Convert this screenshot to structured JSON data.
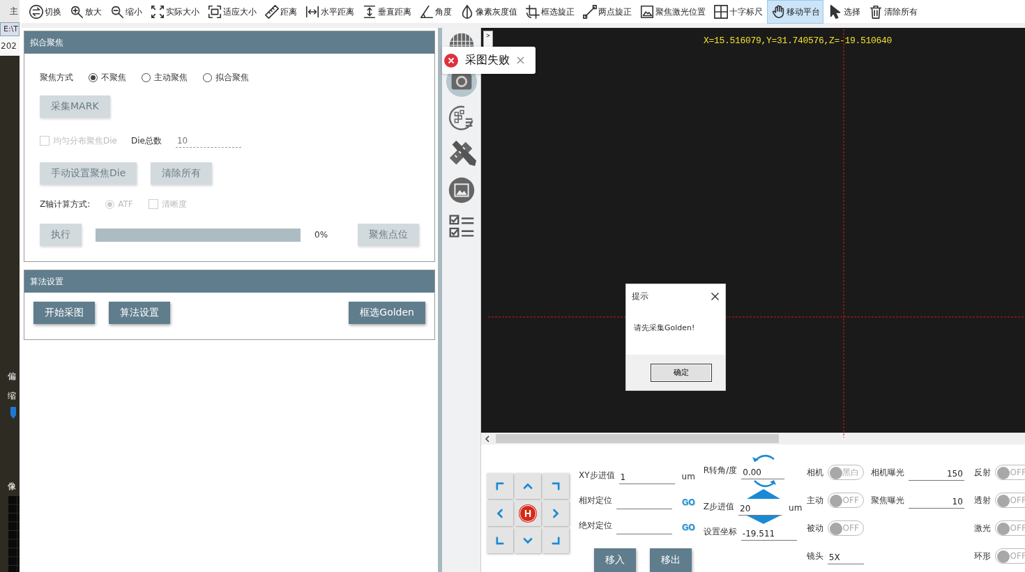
{
  "background_app": {
    "texts": [
      "主",
      "E:\\T",
      "202",
      "偏",
      "缩",
      "像"
    ]
  },
  "toolbar": {
    "items": [
      {
        "kind": "swap",
        "label": "切换",
        "selected": false
      },
      {
        "kind": "zoom_in",
        "label": "放大",
        "selected": false
      },
      {
        "kind": "zoom_out",
        "label": "缩小",
        "selected": false
      },
      {
        "kind": "actual_size",
        "label": "实际大小",
        "selected": false
      },
      {
        "kind": "fit",
        "label": "适应大小",
        "selected": false
      },
      {
        "kind": "ruler",
        "label": "距离",
        "selected": false
      },
      {
        "kind": "hdist",
        "label": "水平距离",
        "selected": false
      },
      {
        "kind": "vdist",
        "label": "垂直距离",
        "selected": false
      },
      {
        "kind": "angle",
        "label": "角度",
        "selected": false
      },
      {
        "kind": "gray",
        "label": "像素灰度值",
        "selected": false
      },
      {
        "kind": "rotate_frame",
        "label": "框选旋正",
        "selected": false
      },
      {
        "kind": "two_point",
        "label": "两点旋正",
        "selected": false
      },
      {
        "kind": "image",
        "label": "聚焦激光位置",
        "selected": false
      },
      {
        "kind": "cross_ruler",
        "label": "十字标尺",
        "selected": false
      },
      {
        "kind": "hand",
        "label": "移动平台",
        "selected": true
      },
      {
        "kind": "cursor",
        "label": "选择",
        "selected": false
      },
      {
        "kind": "trash",
        "label": "清除所有",
        "selected": false
      }
    ]
  },
  "focus_section": {
    "title": "拟合聚焦",
    "mode": {
      "label": "聚焦方式",
      "options": [
        {
          "label": "不聚焦",
          "selected": true
        },
        {
          "label": "主动聚焦",
          "selected": false
        },
        {
          "label": "拟合聚焦",
          "selected": false
        }
      ]
    },
    "mark_button": {
      "label": "采集MARK",
      "disabled": true
    },
    "even_checkbox": {
      "label": "均匀分布聚焦Die",
      "checked": false,
      "disabled": true
    },
    "die_count": {
      "label": "Die总数",
      "value": "10",
      "disabled": true
    },
    "buttons": [
      {
        "label": "手动设置聚焦Die",
        "disabled": true
      },
      {
        "label": "清除所有",
        "disabled": true
      }
    ],
    "z_mode": {
      "label": "Z轴计算方式:",
      "atf": {
        "label": "ATF",
        "selected": true,
        "disabled": true
      },
      "clarity": {
        "label": "清晰度",
        "checked": false,
        "disabled": true
      }
    },
    "execute": {
      "label": "执行",
      "disabled": true
    },
    "progress": {
      "level": 0,
      "reading": "0%"
    },
    "points_button": {
      "label": "聚焦点位",
      "disabled": true
    }
  },
  "algorithm_section": {
    "title": "算法设置",
    "buttons": [
      {
        "label": "开始采图",
        "disabled": false
      },
      {
        "label": "算法设置",
        "disabled": false
      },
      {
        "label": "框选Golden",
        "disabled": false
      }
    ]
  },
  "side_tools": [
    {
      "kind": "grid",
      "selected": false
    },
    {
      "kind": "camera",
      "selected": true
    },
    {
      "kind": "wafer",
      "selected": false
    },
    {
      "kind": "tools",
      "selected": false
    },
    {
      "kind": "frame",
      "selected": false
    },
    {
      "kind": "checklist",
      "selected": false
    }
  ],
  "viewer": {
    "expand_button": ">",
    "coordinates": "X=15.516079,Y=31.740576,Z=-19.510640"
  },
  "toast": {
    "message": "采图失败"
  },
  "dialog": {
    "title": "提示",
    "message": "请先采集Golden!",
    "button": "确定"
  },
  "motion": {
    "pad": [
      {
        "kind": "tl"
      },
      {
        "kind": "up"
      },
      {
        "kind": "tr"
      },
      {
        "kind": "left"
      },
      {
        "kind": "home",
        "label": "H"
      },
      {
        "kind": "right"
      },
      {
        "kind": "bl"
      },
      {
        "kind": "down"
      },
      {
        "kind": "br"
      }
    ],
    "xy_step": {
      "label": "XY步进值",
      "value": "1",
      "unit": "um"
    },
    "positions": [
      {
        "label": "相对定位",
        "go": "GO"
      },
      {
        "label": "绝对定位",
        "go": "GO"
      }
    ],
    "buttons": [
      "移入",
      "移出"
    ]
  },
  "axis": {
    "rotation": {
      "label": "R转角/度",
      "value": "0.00"
    },
    "z_step": {
      "label": "Z步进值",
      "value": "20",
      "unit": "um"
    },
    "set_coord": {
      "label": "设置坐标",
      "value": "-19.511"
    }
  },
  "camera": {
    "toggles": [
      {
        "label": "相机",
        "text": "黑白",
        "on": false
      },
      {
        "label": "主动",
        "text": "OFF",
        "on": false
      },
      {
        "label": "被动",
        "text": "OFF",
        "on": false
      }
    ],
    "lens": {
      "label": "镜头",
      "value": "5X"
    },
    "exposures": [
      {
        "label": "相机曝光",
        "value": "150"
      },
      {
        "label": "聚焦曝光",
        "value": "10"
      }
    ],
    "lights": [
      {
        "label": "反射",
        "text": "OFF",
        "on": false
      },
      {
        "label": "透射",
        "text": "OFF",
        "on": false
      },
      {
        "label": "激光",
        "text": "OFF",
        "on": false
      },
      {
        "label": "环形",
        "text": "OFF",
        "on": false
      }
    ]
  }
}
